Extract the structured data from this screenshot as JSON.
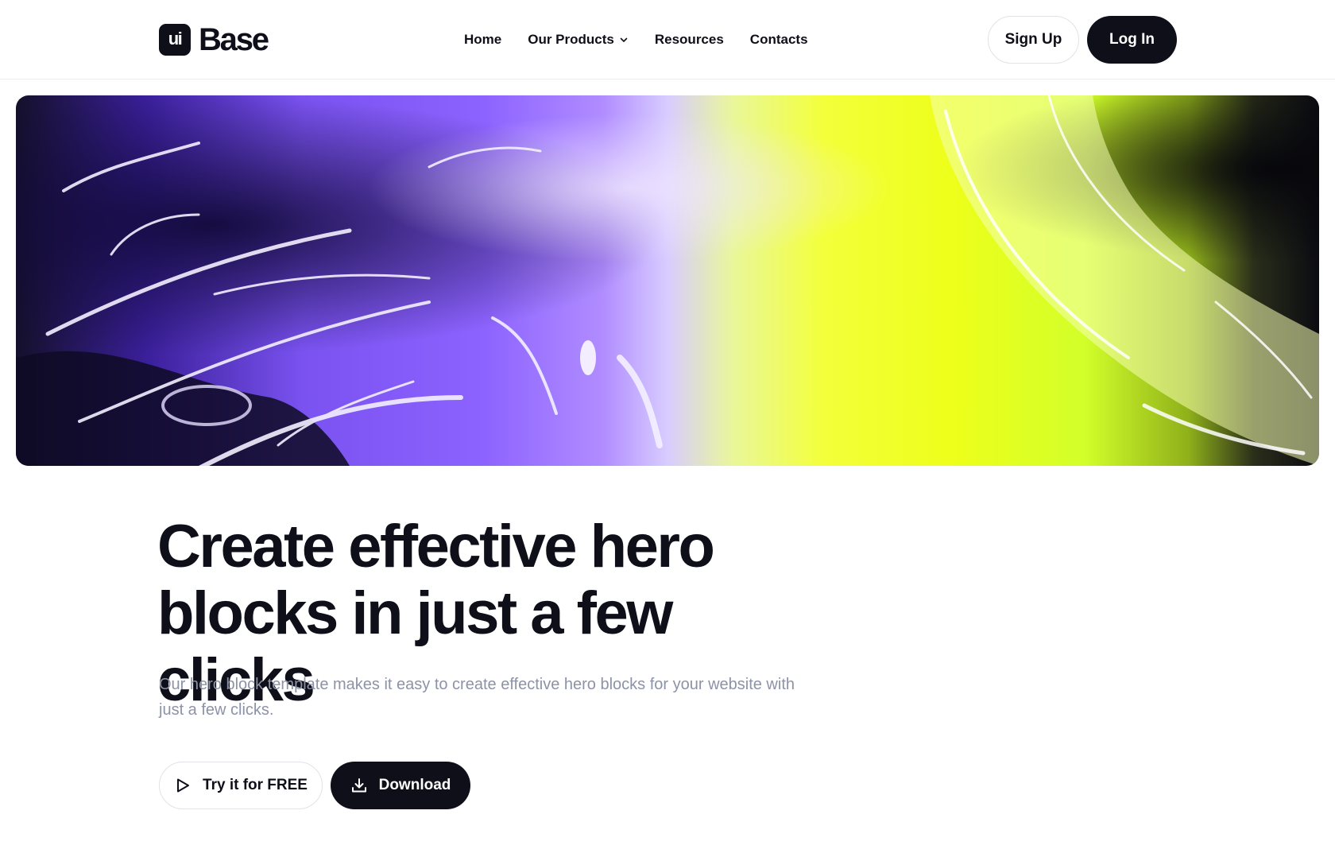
{
  "brand": {
    "logo_mark": "ui",
    "logo_word": "Base"
  },
  "nav": {
    "items": [
      {
        "label": "Home"
      },
      {
        "label": "Our Products",
        "icon": "chevron-down-icon"
      },
      {
        "label": "Resources"
      },
      {
        "label": "Contacts"
      }
    ]
  },
  "auth": {
    "signup_label": "Sign Up",
    "login_label": "Log In"
  },
  "hero": {
    "headline_line1": "Create effective hero",
    "headline_line2": "blocks in just a few clicks",
    "subtitle": "Our hero block template makes it easy to create effective hero blocks for your website with just a few clicks.",
    "primary_cta": {
      "label": "Try it for FREE",
      "icon": "play-icon"
    },
    "secondary_cta": {
      "label": "Download",
      "icon": "download-icon"
    }
  },
  "colors": {
    "ink": "#0f0f1a",
    "muted_text": "#8d93a6",
    "border": "#e2e2e8",
    "hero_purple": "#8d63ff",
    "hero_lime": "#f3ff3a"
  }
}
